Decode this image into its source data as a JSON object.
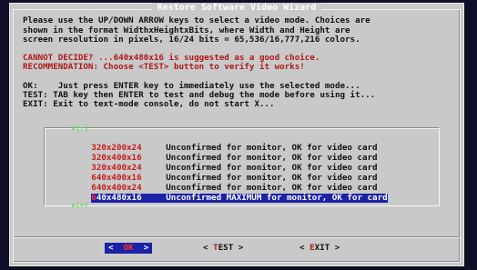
{
  "dialog": {
    "title": "Restore Software Video Wizard",
    "intro_lines": [
      "Please use the UP/DOWN ARROW keys to select a video mode. Choices are",
      "shown in the format WidthxHeightxBits, where Width and Height are",
      "screen resolution in pixels, 16/24 bits = 65,536/16,777,216 colors."
    ],
    "suggest_line": "CANNOT DECIDE? ...640x480x16 is suggested as a good choice.",
    "recommend_line": "RECOMMENDATION: Choose <TEST> button to verify it works!",
    "help_lines": [
      "OK:    Just press ENTER key to immediately use the selected mode...",
      "TEST: TAB key then ENTER to test and debug the mode before using it...",
      "EXIT: Exit to text-mode console, do not start X..."
    ]
  },
  "modes": {
    "scroll_up": "v(-)",
    "scroll_down": "v(+)",
    "items": [
      {
        "mode_first": "3",
        "mode_rest": "20x200x24",
        "desc": "Unconfirmed for monitor, OK for video card"
      },
      {
        "mode_first": "3",
        "mode_rest": "20x400x16",
        "desc": "Unconfirmed for monitor, OK for video card"
      },
      {
        "mode_first": "3",
        "mode_rest": "20x400x24",
        "desc": "Unconfirmed for monitor, OK for video card"
      },
      {
        "mode_first": "6",
        "mode_rest": "40x400x16",
        "desc": "Unconfirmed for monitor, OK for video card"
      },
      {
        "mode_first": "6",
        "mode_rest": "40x400x24",
        "desc": "Unconfirmed for monitor, OK for video card"
      },
      {
        "mode_first": "6",
        "mode_rest": "40x480x16",
        "desc": "Unconfirmed MAXIMUM for monitor, OK for card"
      }
    ],
    "selected_index": 5
  },
  "buttons": {
    "ok": {
      "left": "<",
      "hot": "  OK",
      "right": "  >"
    },
    "test": {
      "left": "< ",
      "hot": "T",
      "rest": "EST >"
    },
    "exit": {
      "left": "< ",
      "hot": "E",
      "rest": "XIT >"
    }
  },
  "colors": {
    "dialog_bg": "#c9c9c9",
    "highlight": "#1b22a6",
    "hotkey": "#b01818",
    "scroll_indicator": "#5fdb5f"
  }
}
